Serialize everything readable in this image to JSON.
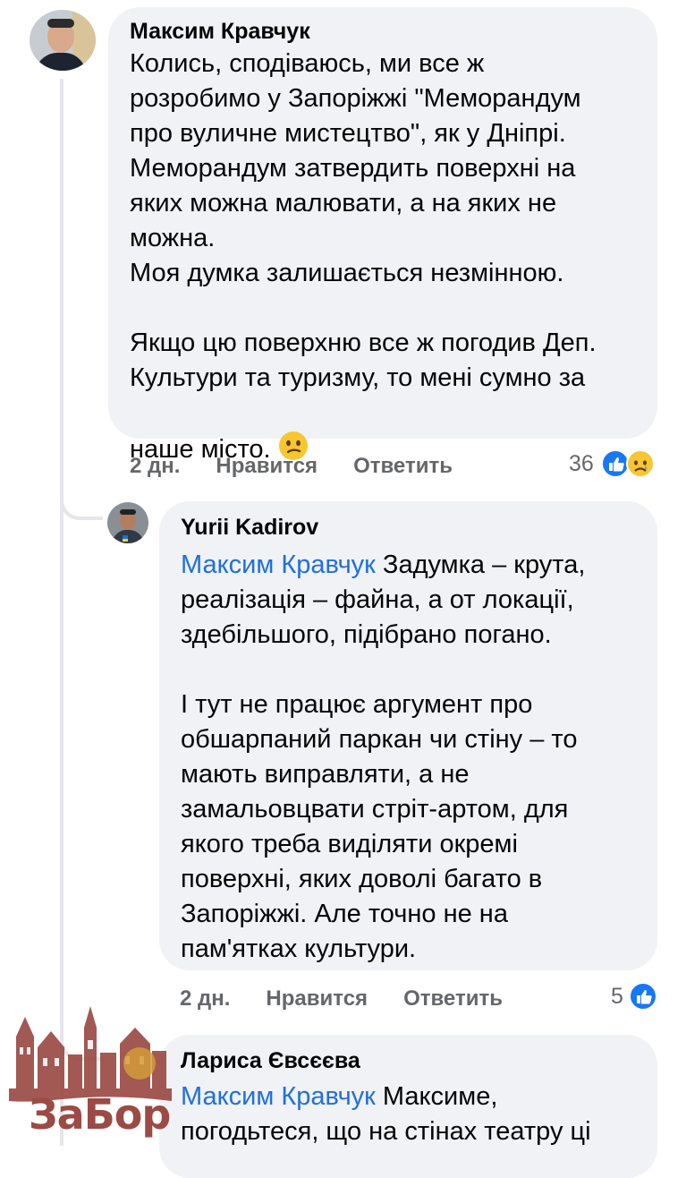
{
  "comments": [
    {
      "author": "Максим Кравчук",
      "text": "Колись, сподіваюсь, ми все ж\nрозробимо у Запоріжжі \"Меморандум\nпро вуличне мистецтво\", як у Дніпрі.\nМеморандум затвердить поверхні на\nяких можна малювати, а на яких не\nможна.\nМоя думка залишається незмінною.\n\nЯкщо цю поверхню все ж погодив Деп.\nКультури та туризму, то мені сумно за\nнаше місто.",
      "emoji": "confused-face",
      "time": "2 дн.",
      "like": "Нравится",
      "reply": "Ответить",
      "reaction_count": "36",
      "reaction_icons": [
        "like-icon",
        "sad-icon"
      ]
    },
    {
      "author": "Yurii Kadirov",
      "mention": "Максим Кравчук",
      "text": " Задумка – крута,\nреалізація – файна, а от локації,\nздебільшого, підібрано погано.\n\nІ тут не працює аргумент про\nобшарпаний паркан чи стіну – то\nмають виправляти, а не\nзамальовцвати стріт-артом, для\nякого треба виділяти окремі\nповерхні, яких доволі багато в\nЗапоріжжі. Але точно не на\nпам'ятках культури.",
      "time": "2 дн.",
      "like": "Нравится",
      "reply": "Ответить",
      "reaction_count": "5",
      "reaction_icons": [
        "like-icon"
      ]
    },
    {
      "author": "Лариса Євсєєва",
      "mention": "Максим Кравчук",
      "text": " Максиме,\nпогодьтеся, що на стінах театру ці"
    }
  ],
  "watermark": {
    "logo_text": "ЗаБор"
  },
  "colors": {
    "bubble": "#f0f2f5",
    "mention": "#216fdb",
    "meta": "#65676b",
    "like_blue": "#1877f2",
    "watermark": "#9b4a45"
  }
}
